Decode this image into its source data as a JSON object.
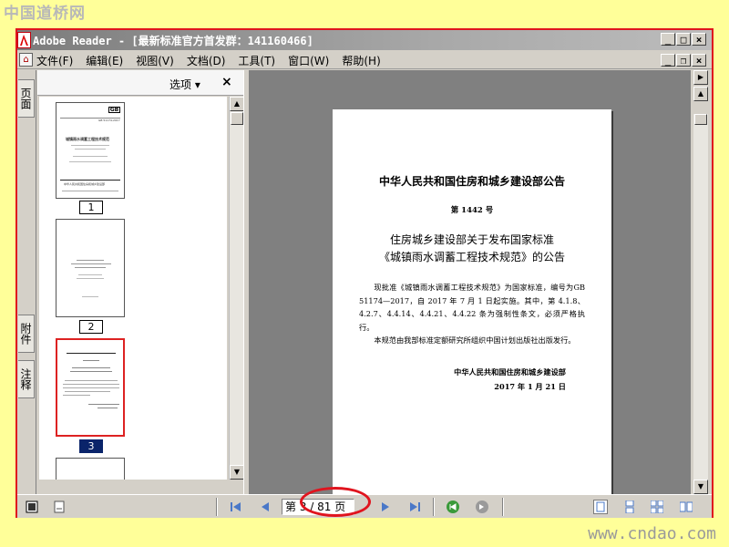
{
  "watermark_top": "中国道桥网",
  "watermark_bottom": "www.cndao.com",
  "window": {
    "title": "Adobe Reader - [最新标准官方首发群：141160466]",
    "buttons": {
      "minimize": "_",
      "maximize": "□",
      "close": "×",
      "restore": "❐"
    }
  },
  "menu": {
    "items": [
      "文件(F)",
      "编辑(E)",
      "视图(V)",
      "文档(D)",
      "工具(T)",
      "窗口(W)",
      "帮助(H)"
    ]
  },
  "nav_tabs": {
    "pages": "页面",
    "attachments": "附件",
    "comments": "注释"
  },
  "thumbnails": {
    "options_label": "选项 ▾",
    "close_label": "×",
    "pages": [
      {
        "label": "1",
        "selected": false
      },
      {
        "label": "2",
        "selected": false
      },
      {
        "label": "3",
        "selected": true
      }
    ],
    "thumb1": {
      "logo": "GB",
      "code": "GB 51174-2017",
      "title": "城镇雨水调蓄工程技术规范",
      "footer": "中华人民共和国住房和城乡建设部"
    }
  },
  "document": {
    "header": "中华人民共和国住房和城乡建设部公告",
    "number": "第 1442 号",
    "title_line1": "住房城乡建设部关于发布国家标准",
    "title_line2": "《城镇雨水调蓄工程技术规范》的公告",
    "para1": "现批准《城镇雨水调蓄工程技术规范》为国家标准，编号为GB 51174—2017，自 2017 年 7 月 1 日起实施。其中，第 4.1.8、4.2.7、4.4.14、4.4.21、4.4.22 条为强制性条文，必须严格执行。",
    "para2": "本规范由我部标准定额研究所组织中国计划出版社出版发行。",
    "sign_org": "中华人民共和国住房和城乡建设部",
    "sign_date": "2017 年 1 月 21 日"
  },
  "status": {
    "page_field": "第 3 / 81 页"
  },
  "colors": {
    "highlight_red": "#e0141e",
    "background_yellow": "#ffff99",
    "selection_blue": "#0a246a"
  }
}
